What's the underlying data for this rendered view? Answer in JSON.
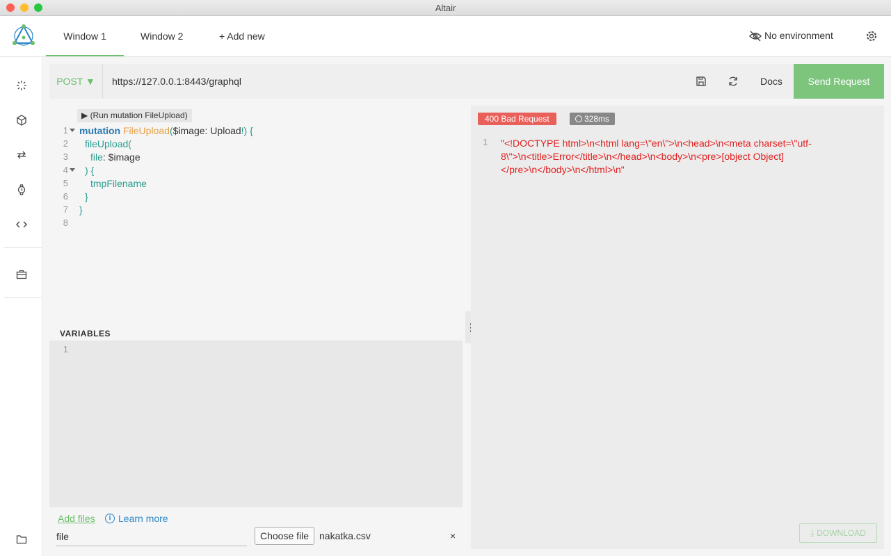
{
  "window": {
    "title": "Altair"
  },
  "tabs": [
    {
      "label": "Window 1",
      "active": true
    },
    {
      "label": "Window 2",
      "active": false
    },
    {
      "label": "+ Add new",
      "active": false
    }
  ],
  "environment": {
    "label": "No environment"
  },
  "sidebar": {
    "icons": [
      "loading-icon",
      "cube-icon",
      "repeat-icon",
      "watch-icon",
      "code-icon",
      "briefcase-icon",
      "folder-icon"
    ]
  },
  "request": {
    "method": "POST ▼",
    "url": "https://127.0.0.1:8443/graphql",
    "docs_label": "Docs",
    "send_label": "Send Request"
  },
  "query": {
    "run_hint": "▶ (Run mutation FileUpload)",
    "line_numbers": [
      "1",
      "2",
      "3",
      "4",
      "5",
      "6",
      "7",
      "8"
    ],
    "lines": {
      "l1_kw": "mutation",
      "l1_fn": "FileUpload",
      "l1_paren": "(",
      "l1_args": "$image: Upload",
      "l1_end": "!) {",
      "l2": "fileUpload(",
      "l3_field": "file",
      "l3_rest": ": $image",
      "l4": ") {",
      "l5": "tmpFilename",
      "l6": "}",
      "l7": "}"
    }
  },
  "variables": {
    "label": "VARIABLES",
    "line_number": "1"
  },
  "files": {
    "add_files": "Add files",
    "learn_more": "Learn more",
    "name_value": "file",
    "choose_label": "Choose file",
    "chosen_file": "nakatka.csv",
    "remove": "×"
  },
  "response": {
    "status": "400 Bad Request",
    "time": "328ms",
    "line_number": "1",
    "body_line1": "\"<!DOCTYPE html>\\n<html lang=\\\"en\\\">\\n<head>\\n<meta charset=\\\"utf-",
    "body_line2": "8\\\">\\n<title>Error</title>\\n</head>\\n<body>\\n<pre>[object Object]",
    "body_line3": "</pre>\\n</body>\\n</html>\\n\"",
    "download_label": "DOWNLOAD"
  },
  "colors": {
    "accent": "#7dc47d",
    "error": "#e9605a",
    "error_text": "#e02020"
  }
}
